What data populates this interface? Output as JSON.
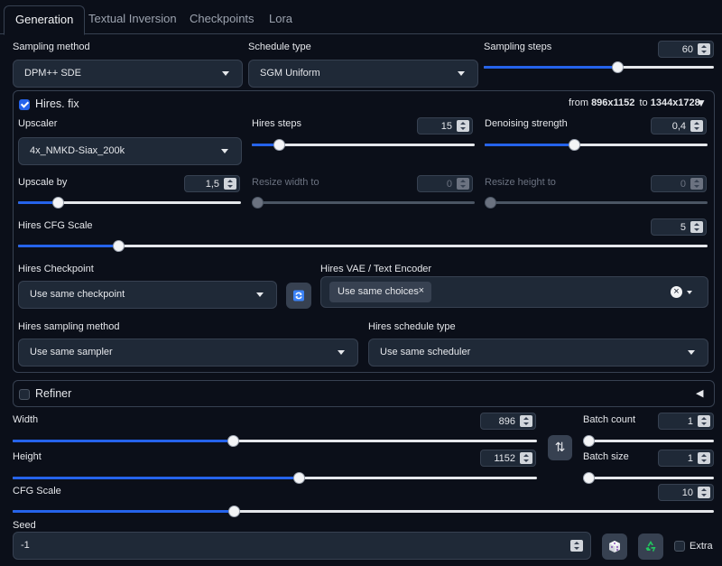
{
  "tabs": [
    {
      "label": "Generation"
    },
    {
      "label": "Textual Inversion"
    },
    {
      "label": "Checkpoints"
    },
    {
      "label": "Lora"
    }
  ],
  "sampling": {
    "method_label": "Sampling method",
    "method_value": "DPM++ SDE",
    "schedule_label": "Schedule type",
    "schedule_value": "SGM Uniform",
    "steps_label": "Sampling steps",
    "steps_value": "60",
    "steps_fraction": 0.58
  },
  "hires": {
    "title": "Hires. fix",
    "enabled": true,
    "from_word": "from",
    "from_size": "896x1152",
    "to_word": "to",
    "to_size": "1344x1728",
    "collapse_glyph": "▼",
    "upscaler_label": "Upscaler",
    "upscaler_value": "4x_NMKD-Siax_200k",
    "steps_label": "Hires steps",
    "steps_value": "15",
    "steps_fraction": 0.12,
    "denoise_label": "Denoising strength",
    "denoise_value": "0,4",
    "denoise_fraction": 0.4,
    "upscale_by_label": "Upscale by",
    "upscale_by_value": "1,5",
    "upscale_by_fraction": 0.18,
    "resize_w_label": "Resize width to",
    "resize_w_value": "0",
    "resize_h_label": "Resize height to",
    "resize_h_value": "0",
    "cfg_label": "Hires CFG Scale",
    "cfg_value": "5",
    "cfg_fraction": 0.145,
    "checkpoint_label": "Hires Checkpoint",
    "checkpoint_value": "Use same checkpoint",
    "vae_label": "Hires VAE / Text Encoder",
    "vae_chip": "Use same choices",
    "chip_remove": "×",
    "clear_all": "×",
    "sampler_label": "Hires sampling method",
    "sampler_value": "Use same sampler",
    "scheduler_label": "Hires schedule type",
    "scheduler_value": "Use same scheduler"
  },
  "refiner": {
    "title": "Refiner",
    "enabled": false,
    "expand_glyph": "◀"
  },
  "size": {
    "width_label": "Width",
    "width_value": "896",
    "width_fraction": 0.42,
    "height_label": "Height",
    "height_value": "1152",
    "height_fraction": 0.545,
    "swap_glyph": "⇅"
  },
  "batch": {
    "count_label": "Batch count",
    "count_value": "1",
    "count_fraction": 0.0,
    "size_label": "Batch size",
    "size_value": "1",
    "size_fraction": 0.0
  },
  "cfg": {
    "label": "CFG Scale",
    "value": "10",
    "fraction": 0.315
  },
  "seed": {
    "label": "Seed",
    "value": "-1",
    "extra_label": "Extra",
    "extra_enabled": false
  },
  "colors": {
    "accent": "#2563eb",
    "background": "#0b0f19",
    "input": "#1f2937",
    "border": "#374151",
    "recycle": "#22c55e"
  }
}
